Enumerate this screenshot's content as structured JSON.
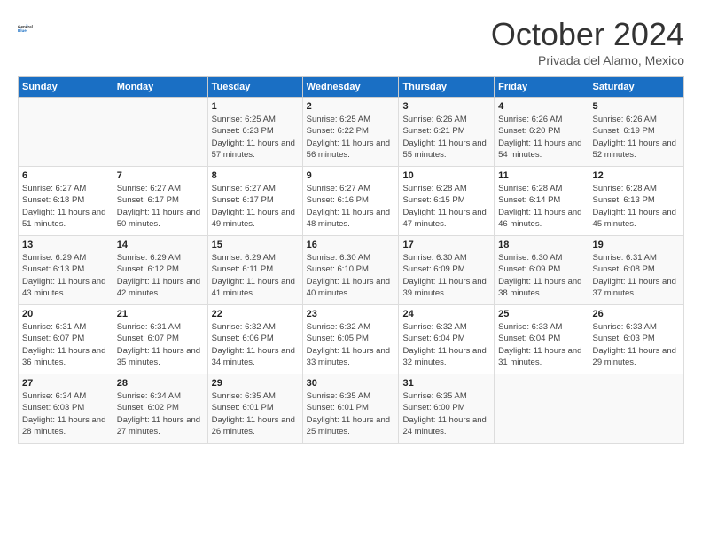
{
  "header": {
    "logo_line1": "General",
    "logo_line2": "Blue",
    "month_title": "October 2024",
    "location": "Privada del Alamo, Mexico"
  },
  "days_of_week": [
    "Sunday",
    "Monday",
    "Tuesday",
    "Wednesday",
    "Thursday",
    "Friday",
    "Saturday"
  ],
  "weeks": [
    [
      {
        "day": "",
        "sunrise": "",
        "sunset": "",
        "daylight": ""
      },
      {
        "day": "",
        "sunrise": "",
        "sunset": "",
        "daylight": ""
      },
      {
        "day": "1",
        "sunrise": "Sunrise: 6:25 AM",
        "sunset": "Sunset: 6:23 PM",
        "daylight": "Daylight: 11 hours and 57 minutes."
      },
      {
        "day": "2",
        "sunrise": "Sunrise: 6:25 AM",
        "sunset": "Sunset: 6:22 PM",
        "daylight": "Daylight: 11 hours and 56 minutes."
      },
      {
        "day": "3",
        "sunrise": "Sunrise: 6:26 AM",
        "sunset": "Sunset: 6:21 PM",
        "daylight": "Daylight: 11 hours and 55 minutes."
      },
      {
        "day": "4",
        "sunrise": "Sunrise: 6:26 AM",
        "sunset": "Sunset: 6:20 PM",
        "daylight": "Daylight: 11 hours and 54 minutes."
      },
      {
        "day": "5",
        "sunrise": "Sunrise: 6:26 AM",
        "sunset": "Sunset: 6:19 PM",
        "daylight": "Daylight: 11 hours and 52 minutes."
      }
    ],
    [
      {
        "day": "6",
        "sunrise": "Sunrise: 6:27 AM",
        "sunset": "Sunset: 6:18 PM",
        "daylight": "Daylight: 11 hours and 51 minutes."
      },
      {
        "day": "7",
        "sunrise": "Sunrise: 6:27 AM",
        "sunset": "Sunset: 6:17 PM",
        "daylight": "Daylight: 11 hours and 50 minutes."
      },
      {
        "day": "8",
        "sunrise": "Sunrise: 6:27 AM",
        "sunset": "Sunset: 6:17 PM",
        "daylight": "Daylight: 11 hours and 49 minutes."
      },
      {
        "day": "9",
        "sunrise": "Sunrise: 6:27 AM",
        "sunset": "Sunset: 6:16 PM",
        "daylight": "Daylight: 11 hours and 48 minutes."
      },
      {
        "day": "10",
        "sunrise": "Sunrise: 6:28 AM",
        "sunset": "Sunset: 6:15 PM",
        "daylight": "Daylight: 11 hours and 47 minutes."
      },
      {
        "day": "11",
        "sunrise": "Sunrise: 6:28 AM",
        "sunset": "Sunset: 6:14 PM",
        "daylight": "Daylight: 11 hours and 46 minutes."
      },
      {
        "day": "12",
        "sunrise": "Sunrise: 6:28 AM",
        "sunset": "Sunset: 6:13 PM",
        "daylight": "Daylight: 11 hours and 45 minutes."
      }
    ],
    [
      {
        "day": "13",
        "sunrise": "Sunrise: 6:29 AM",
        "sunset": "Sunset: 6:13 PM",
        "daylight": "Daylight: 11 hours and 43 minutes."
      },
      {
        "day": "14",
        "sunrise": "Sunrise: 6:29 AM",
        "sunset": "Sunset: 6:12 PM",
        "daylight": "Daylight: 11 hours and 42 minutes."
      },
      {
        "day": "15",
        "sunrise": "Sunrise: 6:29 AM",
        "sunset": "Sunset: 6:11 PM",
        "daylight": "Daylight: 11 hours and 41 minutes."
      },
      {
        "day": "16",
        "sunrise": "Sunrise: 6:30 AM",
        "sunset": "Sunset: 6:10 PM",
        "daylight": "Daylight: 11 hours and 40 minutes."
      },
      {
        "day": "17",
        "sunrise": "Sunrise: 6:30 AM",
        "sunset": "Sunset: 6:09 PM",
        "daylight": "Daylight: 11 hours and 39 minutes."
      },
      {
        "day": "18",
        "sunrise": "Sunrise: 6:30 AM",
        "sunset": "Sunset: 6:09 PM",
        "daylight": "Daylight: 11 hours and 38 minutes."
      },
      {
        "day": "19",
        "sunrise": "Sunrise: 6:31 AM",
        "sunset": "Sunset: 6:08 PM",
        "daylight": "Daylight: 11 hours and 37 minutes."
      }
    ],
    [
      {
        "day": "20",
        "sunrise": "Sunrise: 6:31 AM",
        "sunset": "Sunset: 6:07 PM",
        "daylight": "Daylight: 11 hours and 36 minutes."
      },
      {
        "day": "21",
        "sunrise": "Sunrise: 6:31 AM",
        "sunset": "Sunset: 6:07 PM",
        "daylight": "Daylight: 11 hours and 35 minutes."
      },
      {
        "day": "22",
        "sunrise": "Sunrise: 6:32 AM",
        "sunset": "Sunset: 6:06 PM",
        "daylight": "Daylight: 11 hours and 34 minutes."
      },
      {
        "day": "23",
        "sunrise": "Sunrise: 6:32 AM",
        "sunset": "Sunset: 6:05 PM",
        "daylight": "Daylight: 11 hours and 33 minutes."
      },
      {
        "day": "24",
        "sunrise": "Sunrise: 6:32 AM",
        "sunset": "Sunset: 6:04 PM",
        "daylight": "Daylight: 11 hours and 32 minutes."
      },
      {
        "day": "25",
        "sunrise": "Sunrise: 6:33 AM",
        "sunset": "Sunset: 6:04 PM",
        "daylight": "Daylight: 11 hours and 31 minutes."
      },
      {
        "day": "26",
        "sunrise": "Sunrise: 6:33 AM",
        "sunset": "Sunset: 6:03 PM",
        "daylight": "Daylight: 11 hours and 29 minutes."
      }
    ],
    [
      {
        "day": "27",
        "sunrise": "Sunrise: 6:34 AM",
        "sunset": "Sunset: 6:03 PM",
        "daylight": "Daylight: 11 hours and 28 minutes."
      },
      {
        "day": "28",
        "sunrise": "Sunrise: 6:34 AM",
        "sunset": "Sunset: 6:02 PM",
        "daylight": "Daylight: 11 hours and 27 minutes."
      },
      {
        "day": "29",
        "sunrise": "Sunrise: 6:35 AM",
        "sunset": "Sunset: 6:01 PM",
        "daylight": "Daylight: 11 hours and 26 minutes."
      },
      {
        "day": "30",
        "sunrise": "Sunrise: 6:35 AM",
        "sunset": "Sunset: 6:01 PM",
        "daylight": "Daylight: 11 hours and 25 minutes."
      },
      {
        "day": "31",
        "sunrise": "Sunrise: 6:35 AM",
        "sunset": "Sunset: 6:00 PM",
        "daylight": "Daylight: 11 hours and 24 minutes."
      },
      {
        "day": "",
        "sunrise": "",
        "sunset": "",
        "daylight": ""
      },
      {
        "day": "",
        "sunrise": "",
        "sunset": "",
        "daylight": ""
      }
    ]
  ]
}
